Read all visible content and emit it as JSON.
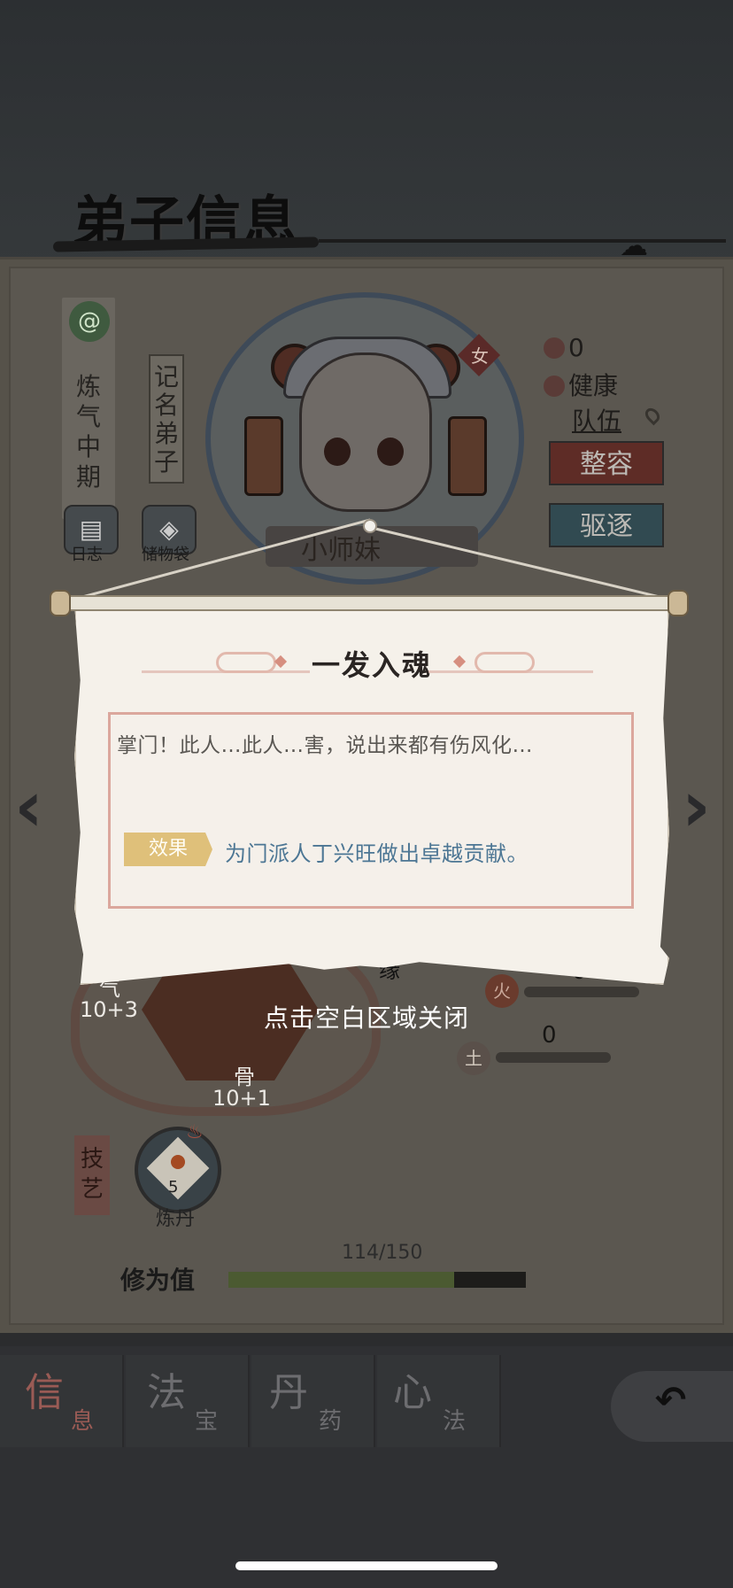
{
  "page": {
    "title": "弟子信息"
  },
  "disciple": {
    "realm": "炼气中期",
    "rank": "记名弟子",
    "name": "小师妹",
    "gender": "女",
    "log_label": "日志",
    "bag_label": "储物袋",
    "stat_count": "0",
    "health": "健康",
    "team_link": "队伍",
    "restyle_button": "整容",
    "expel_button": "驱逐"
  },
  "attributes": {
    "qi_label": "气",
    "qi_value": "10+3",
    "bone_label": "骨",
    "bone_value": "10+1",
    "fate_label": "缘",
    "fire_label": "火",
    "fire_value": "0",
    "earth_label": "土",
    "earth_value": "0"
  },
  "skills": {
    "section_label": "技艺",
    "items": [
      {
        "name": "炼丹",
        "level": "5"
      }
    ]
  },
  "cultivation": {
    "label": "修为值",
    "current": 114,
    "max": 150,
    "display": "114/150"
  },
  "dialog": {
    "title": "一发入魂",
    "description": "掌门！此人…此人…害，说出来都有伤风化…",
    "effect_label": "效果",
    "effect_text": "为门派人丁兴旺做出卓越贡献。",
    "close_hint": "点击空白区域关闭"
  },
  "tabs": [
    {
      "big": "信",
      "small": "息",
      "active": true
    },
    {
      "big": "法",
      "small": "宝",
      "active": false
    },
    {
      "big": "丹",
      "small": "药",
      "active": false
    },
    {
      "big": "心",
      "small": "法",
      "active": false
    }
  ],
  "nav": {
    "prev_arrow": "‹",
    "next_arrow": "›",
    "back_glyph": "↶"
  },
  "colors": {
    "overlay": "#2b2c2e",
    "effect_badge": "#dfc07a",
    "effect_text": "#4c7694",
    "dialog_bg": "#f5f1ea",
    "dialog_border": "#dba79d"
  },
  "icons": {
    "realm": "swirl-icon",
    "log": "scroll-book-icon",
    "bag": "pouch-icon",
    "stat": "brain-icon",
    "health": "heart-icon",
    "team": "location-pin-icon",
    "skill_flame": "flame-icon"
  }
}
